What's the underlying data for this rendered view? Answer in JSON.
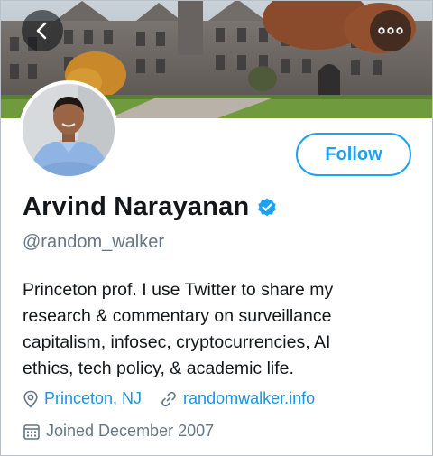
{
  "header": {
    "back_icon": "chevron-left-icon",
    "more_icon": "more-horizontal-icon"
  },
  "profile": {
    "display_name": "Arvind Narayanan",
    "verified_icon": "verified-badge-icon",
    "handle": "@random_walker",
    "follow_label": "Follow",
    "bio_lines": [
      "Princeton prof. I use Twitter to share my",
      "research & commentary on surveillance",
      "capitalism, infosec, cryptocurrencies, AI",
      "ethics, tech policy, & academic life."
    ],
    "location": "Princeton, NJ",
    "website": "randomwalker.info",
    "joined": "Joined December 2007"
  },
  "colors": {
    "accent": "#1da1f2",
    "link": "#1b95e0",
    "secondary_text": "#657786",
    "primary_text": "#14171a"
  }
}
